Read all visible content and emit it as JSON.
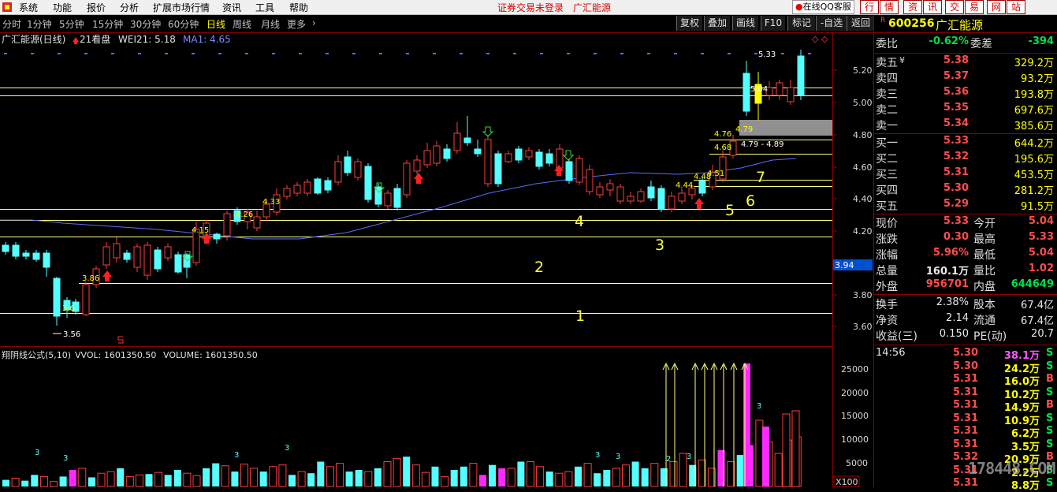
{
  "menubar": {
    "items": [
      "系统",
      "功能",
      "报价",
      "分析",
      "扩展市场行情",
      "资讯",
      "工具",
      "帮助"
    ],
    "status": [
      "证券交易未登录",
      "广汇能源"
    ],
    "qq_service": "在线QQ客服",
    "right_buttons": [
      "行",
      "情",
      "资",
      "讯",
      "交",
      "易",
      "网",
      "站"
    ]
  },
  "tabs": {
    "items": [
      "分时",
      "1分钟",
      "5分钟",
      "15分钟",
      "30分钟",
      "60分钟",
      "日线",
      "周线",
      "月线",
      "更多"
    ],
    "active": "日线",
    "more_arrow": "›"
  },
  "chart_toolbar": [
    "复权",
    "叠加",
    "画线",
    "F10",
    "标记",
    "-自选",
    "返回"
  ],
  "chart_header": {
    "name": "广汇能源(日线)",
    "sig": "21看盘",
    "wei": "WEI21: 5.18",
    "ma": "MA1: 4.65"
  },
  "vol_header": {
    "formula": "翔阴线公式(5,10)",
    "vvol": "VVOL: 1601350.50",
    "volume": "VOLUME: 1601350.50"
  },
  "price_axis": [
    "5.20",
    "5.00",
    "4.80",
    "4.60",
    "4.40",
    "4.20",
    "3.94",
    "3.80",
    "3.60"
  ],
  "vol_axis": [
    "25000",
    "20000",
    "15000",
    "10000",
    "5000"
  ],
  "vol_unit": "X100",
  "price_annotations": [
    "5.33",
    "5.04",
    "4.79",
    "4.79 - 4.89",
    "4.76",
    "4.68",
    "4.51",
    "4.48",
    "4.44",
    "4.33",
    "4.26",
    "4.15",
    "3.86",
    "3.6",
    "3.56"
  ],
  "zone_labels": [
    "1",
    "2",
    "3",
    "4",
    "5",
    "6",
    "7"
  ],
  "vol_annotations": [
    "3",
    "3",
    "3",
    "3",
    "3",
    "3",
    "2",
    "3",
    "3"
  ],
  "colors": {
    "up": "#ff3c3c",
    "down": "#54ffff",
    "ma": "#5a6cff",
    "level": "#ffff80",
    "highlight_vol": "#ff28ff",
    "yellow": "#ffff00"
  },
  "quote": {
    "code": "600256",
    "name": "广汇能源",
    "r_mark": "R",
    "webi_label": "委比",
    "webi": "-0.62%",
    "weicha_label": "委差",
    "weicha": "-394",
    "sell": [
      {
        "label": "卖五",
        "price": "5.38",
        "vol": "329.2万",
        "mark": "¥"
      },
      {
        "label": "卖四",
        "price": "5.37",
        "vol": "93.2万",
        "mark": ""
      },
      {
        "label": "卖三",
        "price": "5.36",
        "vol": "193.8万",
        "mark": ""
      },
      {
        "label": "卖二",
        "price": "5.35",
        "vol": "697.6万",
        "mark": ""
      },
      {
        "label": "卖一",
        "price": "5.34",
        "vol": "385.6万",
        "mark": ""
      }
    ],
    "buy": [
      {
        "label": "买一",
        "price": "5.33",
        "vol": "644.2万"
      },
      {
        "label": "买二",
        "price": "5.32",
        "vol": "195.6万"
      },
      {
        "label": "买三",
        "price": "5.31",
        "vol": "453.5万"
      },
      {
        "label": "买四",
        "price": "5.30",
        "vol": "281.2万"
      },
      {
        "label": "买五",
        "price": "5.29",
        "vol": "91.5万"
      }
    ],
    "stats": [
      {
        "l1": "现价",
        "v1": "5.33",
        "c1": "red",
        "l2": "今开",
        "v2": "5.04",
        "c2": "red"
      },
      {
        "l1": "涨跌",
        "v1": "0.30",
        "c1": "red",
        "l2": "最高",
        "v2": "5.33",
        "c2": "red"
      },
      {
        "l1": "涨幅",
        "v1": "5.96%",
        "c1": "red",
        "l2": "最低",
        "v2": "5.04",
        "c2": "red"
      },
      {
        "l1": "总量",
        "v1": "160.1万",
        "c1": "white",
        "l2": "量比",
        "v2": "1.02",
        "c2": "red"
      },
      {
        "l1": "外盘",
        "v1": "956701",
        "c1": "red",
        "l2": "内盘",
        "v2": "644649",
        "c2": "green"
      }
    ],
    "stats2": [
      {
        "l1": "换手",
        "v1": "2.38%",
        "l2": "股本",
        "v2": "67.4亿"
      },
      {
        "l1": "净资",
        "v1": "2.14",
        "l2": "流通",
        "v2": "67.4亿"
      },
      {
        "l1": "收益(三)",
        "v1": "0.150",
        "l2": "PE(动)",
        "v2": "20.7"
      }
    ],
    "ticks": [
      {
        "time": "14:56",
        "price": "5.30",
        "vol": "38.1万",
        "side": "S"
      },
      {
        "time": "",
        "price": "5.30",
        "vol": "24.2万",
        "side": "S"
      },
      {
        "time": "",
        "price": "5.31",
        "vol": "16.0万",
        "side": "B"
      },
      {
        "time": "",
        "price": "5.31",
        "vol": "10.2万",
        "side": "S"
      },
      {
        "time": "",
        "price": "5.31",
        "vol": "14.9万",
        "side": "B"
      },
      {
        "time": "",
        "price": "5.31",
        "vol": "10.9万",
        "side": "S"
      },
      {
        "time": "",
        "price": "5.31",
        "vol": "6.2万",
        "side": "S"
      },
      {
        "time": "",
        "price": "5.31",
        "vol": "3.5万",
        "side": "S"
      },
      {
        "time": "",
        "price": "5.32",
        "vol": "20.9万",
        "side": "B"
      },
      {
        "time": "",
        "price": "5.31",
        "vol": "2.2万",
        "side": "S"
      },
      {
        "time": "",
        "price": "5.31",
        "vol": "8.8万",
        "side": "S"
      }
    ]
  },
  "watermark": "178448.COM"
}
